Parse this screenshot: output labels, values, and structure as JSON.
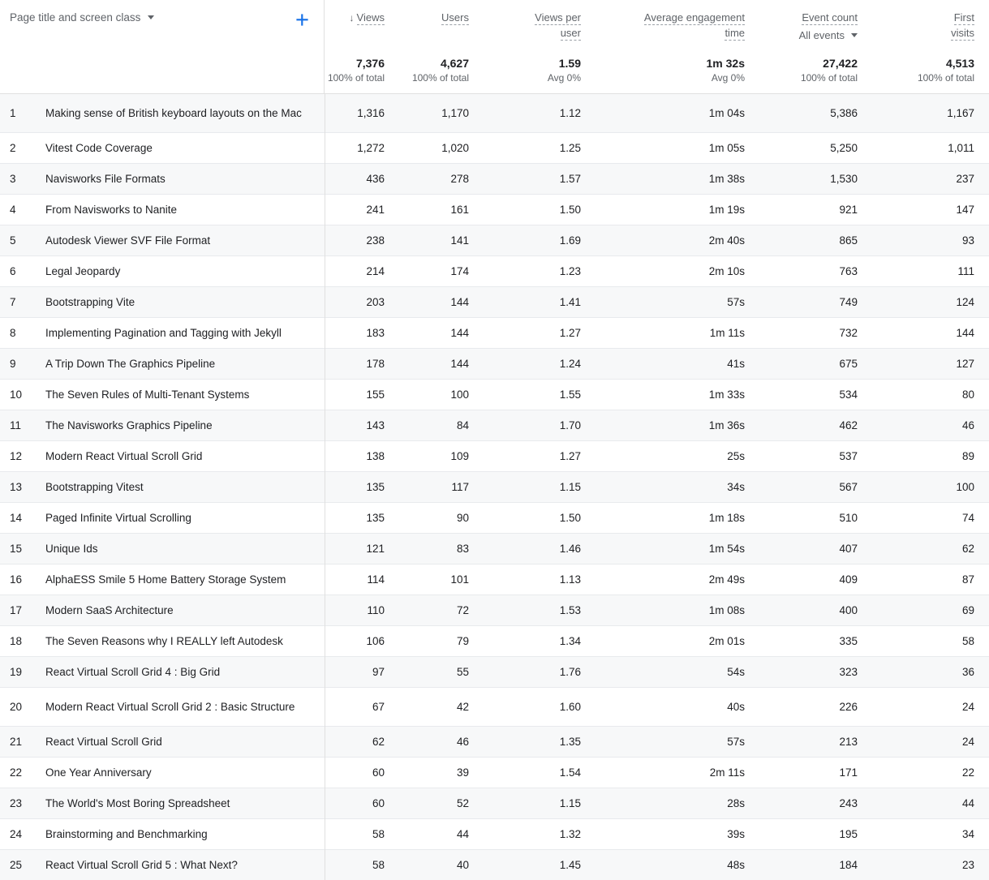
{
  "dimension": {
    "label": "Page title and screen class",
    "caret_icon": "chevron-down-icon",
    "add_icon": "plus-icon"
  },
  "columns": [
    {
      "id": "views",
      "title": "Views",
      "sort_icon": "arrow-down-icon",
      "sorted": true,
      "total": "7,376",
      "total_sub": "100% of total"
    },
    {
      "id": "users",
      "title": "Users",
      "total": "4,627",
      "total_sub": "100% of total"
    },
    {
      "id": "views_per_user",
      "title": "Views per",
      "title2": "user",
      "total": "1.59",
      "total_sub": "Avg 0%"
    },
    {
      "id": "avg_engagement_time",
      "title": "Average engagement",
      "title2": "time",
      "total": "1m 32s",
      "total_sub": "Avg 0%"
    },
    {
      "id": "event_count",
      "title": "Event count",
      "selector": "All events",
      "selector_caret": "chevron-down-icon",
      "total": "27,422",
      "total_sub": "100% of total"
    },
    {
      "id": "first_visits",
      "title": "First",
      "title2": "visits",
      "total": "4,513",
      "total_sub": "100% of total"
    }
  ],
  "rows": [
    {
      "rank": "1",
      "page": "Making sense of British keyboard layouts on the Mac",
      "views": "1,316",
      "users": "1,170",
      "views_per_user": "1.12",
      "avg_engagement_time": "1m 04s",
      "event_count": "5,386",
      "first_visits": "1,167",
      "tall": true
    },
    {
      "rank": "2",
      "page": "Vitest Code Coverage",
      "views": "1,272",
      "users": "1,020",
      "views_per_user": "1.25",
      "avg_engagement_time": "1m 05s",
      "event_count": "5,250",
      "first_visits": "1,011"
    },
    {
      "rank": "3",
      "page": "Navisworks File Formats",
      "views": "436",
      "users": "278",
      "views_per_user": "1.57",
      "avg_engagement_time": "1m 38s",
      "event_count": "1,530",
      "first_visits": "237"
    },
    {
      "rank": "4",
      "page": "From Navisworks to Nanite",
      "views": "241",
      "users": "161",
      "views_per_user": "1.50",
      "avg_engagement_time": "1m 19s",
      "event_count": "921",
      "first_visits": "147"
    },
    {
      "rank": "5",
      "page": "Autodesk Viewer SVF File Format",
      "views": "238",
      "users": "141",
      "views_per_user": "1.69",
      "avg_engagement_time": "2m 40s",
      "event_count": "865",
      "first_visits": "93"
    },
    {
      "rank": "6",
      "page": "Legal Jeopardy",
      "views": "214",
      "users": "174",
      "views_per_user": "1.23",
      "avg_engagement_time": "2m 10s",
      "event_count": "763",
      "first_visits": "111"
    },
    {
      "rank": "7",
      "page": "Bootstrapping Vite",
      "views": "203",
      "users": "144",
      "views_per_user": "1.41",
      "avg_engagement_time": "57s",
      "event_count": "749",
      "first_visits": "124"
    },
    {
      "rank": "8",
      "page": "Implementing Pagination and Tagging with Jekyll",
      "views": "183",
      "users": "144",
      "views_per_user": "1.27",
      "avg_engagement_time": "1m 11s",
      "event_count": "732",
      "first_visits": "144"
    },
    {
      "rank": "9",
      "page": "A Trip Down The Graphics Pipeline",
      "views": "178",
      "users": "144",
      "views_per_user": "1.24",
      "avg_engagement_time": "41s",
      "event_count": "675",
      "first_visits": "127"
    },
    {
      "rank": "10",
      "page": "The Seven Rules of Multi-Tenant Systems",
      "views": "155",
      "users": "100",
      "views_per_user": "1.55",
      "avg_engagement_time": "1m 33s",
      "event_count": "534",
      "first_visits": "80"
    },
    {
      "rank": "11",
      "page": "The Navisworks Graphics Pipeline",
      "views": "143",
      "users": "84",
      "views_per_user": "1.70",
      "avg_engagement_time": "1m 36s",
      "event_count": "462",
      "first_visits": "46"
    },
    {
      "rank": "12",
      "page": "Modern React Virtual Scroll Grid",
      "views": "138",
      "users": "109",
      "views_per_user": "1.27",
      "avg_engagement_time": "25s",
      "event_count": "537",
      "first_visits": "89"
    },
    {
      "rank": "13",
      "page": "Bootstrapping Vitest",
      "views": "135",
      "users": "117",
      "views_per_user": "1.15",
      "avg_engagement_time": "34s",
      "event_count": "567",
      "first_visits": "100"
    },
    {
      "rank": "14",
      "page": "Paged Infinite Virtual Scrolling",
      "views": "135",
      "users": "90",
      "views_per_user": "1.50",
      "avg_engagement_time": "1m 18s",
      "event_count": "510",
      "first_visits": "74"
    },
    {
      "rank": "15",
      "page": "Unique Ids",
      "views": "121",
      "users": "83",
      "views_per_user": "1.46",
      "avg_engagement_time": "1m 54s",
      "event_count": "407",
      "first_visits": "62"
    },
    {
      "rank": "16",
      "page": "AlphaESS Smile 5 Home Battery Storage System",
      "views": "114",
      "users": "101",
      "views_per_user": "1.13",
      "avg_engagement_time": "2m 49s",
      "event_count": "409",
      "first_visits": "87"
    },
    {
      "rank": "17",
      "page": "Modern SaaS Architecture",
      "views": "110",
      "users": "72",
      "views_per_user": "1.53",
      "avg_engagement_time": "1m 08s",
      "event_count": "400",
      "first_visits": "69"
    },
    {
      "rank": "18",
      "page": "The Seven Reasons why I REALLY left Autodesk",
      "views": "106",
      "users": "79",
      "views_per_user": "1.34",
      "avg_engagement_time": "2m 01s",
      "event_count": "335",
      "first_visits": "58"
    },
    {
      "rank": "19",
      "page": "React Virtual Scroll Grid 4 : Big Grid",
      "views": "97",
      "users": "55",
      "views_per_user": "1.76",
      "avg_engagement_time": "54s",
      "event_count": "323",
      "first_visits": "36"
    },
    {
      "rank": "20",
      "page": "Modern React Virtual Scroll Grid 2 : Basic Structure",
      "views": "67",
      "users": "42",
      "views_per_user": "1.60",
      "avg_engagement_time": "40s",
      "event_count": "226",
      "first_visits": "24",
      "tall": true
    },
    {
      "rank": "21",
      "page": "React Virtual Scroll Grid",
      "views": "62",
      "users": "46",
      "views_per_user": "1.35",
      "avg_engagement_time": "57s",
      "event_count": "213",
      "first_visits": "24"
    },
    {
      "rank": "22",
      "page": "One Year Anniversary",
      "views": "60",
      "users": "39",
      "views_per_user": "1.54",
      "avg_engagement_time": "2m 11s",
      "event_count": "171",
      "first_visits": "22"
    },
    {
      "rank": "23",
      "page": "The World's Most Boring Spreadsheet",
      "views": "60",
      "users": "52",
      "views_per_user": "1.15",
      "avg_engagement_time": "28s",
      "event_count": "243",
      "first_visits": "44"
    },
    {
      "rank": "24",
      "page": "Brainstorming and Benchmarking",
      "views": "58",
      "users": "44",
      "views_per_user": "1.32",
      "avg_engagement_time": "39s",
      "event_count": "195",
      "first_visits": "34"
    },
    {
      "rank": "25",
      "page": "React Virtual Scroll Grid 5 : What Next?",
      "views": "58",
      "users": "40",
      "views_per_user": "1.45",
      "avg_engagement_time": "48s",
      "event_count": "184",
      "first_visits": "23"
    }
  ],
  "colors": {
    "accent": "#1a73e8",
    "text": "#202124",
    "muted": "#5f6368",
    "stripe": "#f7f8f9",
    "border": "#e0e0e0"
  }
}
